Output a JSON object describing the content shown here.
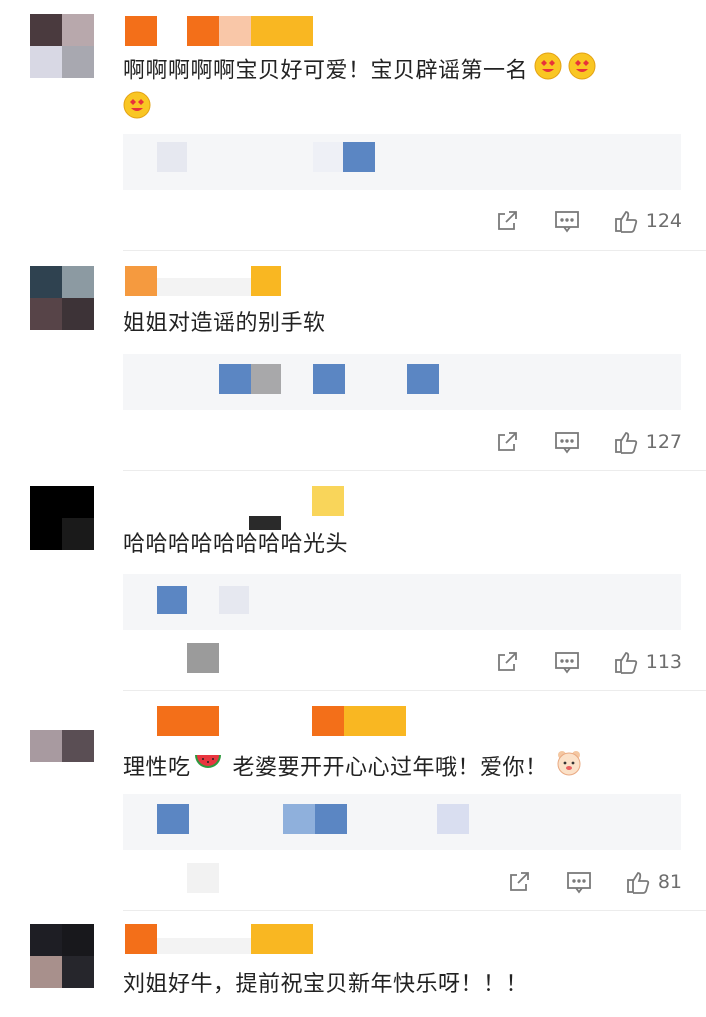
{
  "comments": [
    {
      "text": "啊啊啊啊啊宝贝好可爱！宝贝辟谣第一名",
      "likes": "124"
    },
    {
      "text": "姐姐对造谣的别手软",
      "likes": "127"
    },
    {
      "text": "哈哈哈哈哈哈哈哈光头",
      "likes": "113"
    },
    {
      "text": "理性吃",
      "text_after": "老婆要开开心心过年哦！爱你！",
      "likes": "81"
    },
    {
      "text": "刘姐好牛，提前祝宝贝新年快乐呀！！！"
    }
  ],
  "colors": {
    "accent_orange": "#f47a1f",
    "accent_yellow": "#f7b22a",
    "reply_bg": "#f5f6f8",
    "icon_gray": "#7a7a7a"
  }
}
